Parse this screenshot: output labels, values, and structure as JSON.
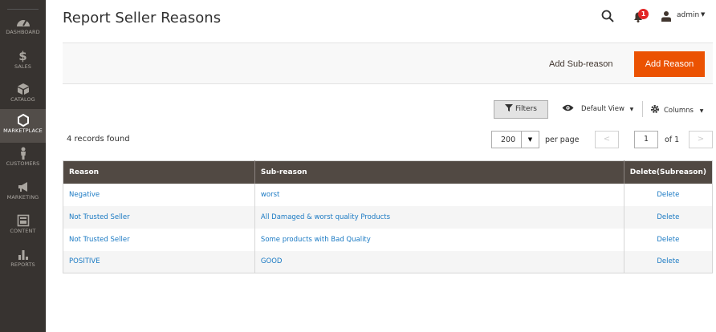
{
  "sidebar": {
    "items": [
      {
        "label": "DASHBOARD",
        "icon": "dashboard-icon"
      },
      {
        "label": "SALES",
        "icon": "dollar-icon"
      },
      {
        "label": "CATALOG",
        "icon": "cube-icon"
      },
      {
        "label": "MARKETPLACE",
        "icon": "hexagon-icon"
      },
      {
        "label": "CUSTOMERS",
        "icon": "person-icon"
      },
      {
        "label": "MARKETING",
        "icon": "megaphone-icon"
      },
      {
        "label": "CONTENT",
        "icon": "layout-icon"
      },
      {
        "label": "REPORTS",
        "icon": "bar-chart-icon"
      }
    ]
  },
  "header": {
    "title": "Report Seller Reasons",
    "notification_count": "1",
    "user": "admin"
  },
  "actions": {
    "add_subreason": "Add Sub-reason",
    "add_reason": "Add Reason"
  },
  "toolbar": {
    "filters": "Filters",
    "default_view": "Default View",
    "columns": "Columns",
    "records_found": "4 records found",
    "per_page_value": "200",
    "per_page_label": "per page",
    "current_page": "1",
    "of_pages": "of 1"
  },
  "grid": {
    "columns": [
      "Reason",
      "Sub-reason",
      "Delete(Subreason)"
    ],
    "rows": [
      [
        "Negative",
        "worst",
        "Delete"
      ],
      [
        "Not Trusted Seller",
        "All Damaged & worst quality Products",
        "Delete"
      ],
      [
        "Not Trusted Seller",
        "Some products with Bad Quality",
        "Delete"
      ],
      [
        "POSITIVE",
        "GOOD",
        "Delete"
      ]
    ]
  },
  "colors": {
    "sidebar_bg": "#373330",
    "accent": "#eb5202",
    "header_bg": "#514943",
    "link": "#1979c3"
  }
}
